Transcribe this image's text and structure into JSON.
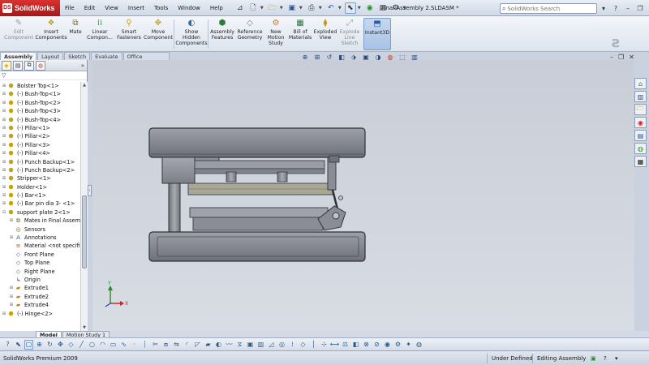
{
  "app": {
    "logo_text": "SolidWorks",
    "document_title": "Final Assembly 2.SLDASM *"
  },
  "menu": [
    "File",
    "Edit",
    "View",
    "Insert",
    "Tools",
    "Window",
    "Help"
  ],
  "search": {
    "placeholder": "SolidWorks Search"
  },
  "ribbon": {
    "buttons": [
      {
        "label": "Edit\nComponent",
        "icon": "edit-component-icon",
        "disabled": true
      },
      {
        "label": "Insert\nComponents",
        "icon": "insert-components-icon"
      },
      {
        "label": "Mate",
        "icon": "mate-icon"
      },
      {
        "label": "Linear\nCompon...",
        "icon": "linear-pattern-icon"
      },
      {
        "label": "Smart\nFasteners",
        "icon": "smart-fasteners-icon"
      },
      {
        "label": "Move\nComponent",
        "icon": "move-component-icon"
      },
      {
        "label": "Show\nHidden\nComponents",
        "icon": "show-hidden-icon"
      },
      {
        "label": "Assembly\nFeatures",
        "icon": "assembly-features-icon"
      },
      {
        "label": "Reference\nGeometry",
        "icon": "reference-geometry-icon"
      },
      {
        "label": "New\nMotion\nStudy",
        "icon": "motion-study-icon"
      },
      {
        "label": "Bill of\nMaterials",
        "icon": "bom-icon"
      },
      {
        "label": "Exploded\nView",
        "icon": "exploded-view-icon"
      },
      {
        "label": "Explode\nLine\nSketch",
        "icon": "explode-line-icon",
        "disabled": true
      },
      {
        "label": "Instant3D",
        "icon": "instant3d-icon",
        "active": true
      }
    ]
  },
  "cm_tabs": [
    "Assembly",
    "Layout",
    "Sketch",
    "Evaluate",
    "Office Products"
  ],
  "tree": [
    {
      "label": "Bolster Top<1>",
      "icon": "part",
      "expander": "+"
    },
    {
      "label": "(-) Bush-Top<1>",
      "icon": "part",
      "expander": "+"
    },
    {
      "label": "(-) Bush-Top<2>",
      "icon": "part",
      "expander": "+"
    },
    {
      "label": "(-) Bush-Top<3>",
      "icon": "part",
      "expander": "+"
    },
    {
      "label": "(-) Bush-Top<4>",
      "icon": "part",
      "expander": "+"
    },
    {
      "label": "(-) Pillar<1>",
      "icon": "part",
      "expander": "+"
    },
    {
      "label": "(-) Pillar<2>",
      "icon": "part",
      "expander": "+"
    },
    {
      "label": "(-) Pillar<3>",
      "icon": "part",
      "expander": "+"
    },
    {
      "label": "(-) Pillar<4>",
      "icon": "part",
      "expander": "+"
    },
    {
      "label": "(-) Punch Backup<1>",
      "icon": "part",
      "expander": "+"
    },
    {
      "label": "(-) Punch Backup<2>",
      "icon": "part",
      "expander": "+"
    },
    {
      "label": "Stripper<1>",
      "icon": "part",
      "expander": "+"
    },
    {
      "label": "Holder<1>",
      "icon": "part",
      "expander": "+"
    },
    {
      "label": "(-) Bar<1>",
      "icon": "part",
      "expander": "+"
    },
    {
      "label": "(-) Bar pin dia 3- <1>",
      "icon": "part",
      "expander": "+"
    },
    {
      "label": "support plate 2<1>",
      "icon": "part",
      "expander": "-"
    },
    {
      "label": "Mates in Final Assem",
      "icon": "mates",
      "expander": "+",
      "indent": 1
    },
    {
      "label": "Sensors",
      "icon": "sensor",
      "expander": "",
      "indent": 1
    },
    {
      "label": "Annotations",
      "icon": "annot",
      "expander": "+",
      "indent": 1
    },
    {
      "label": "Material <not specifi",
      "icon": "mat",
      "expander": "",
      "indent": 1
    },
    {
      "label": "Front Plane",
      "icon": "plane",
      "expander": "",
      "indent": 1
    },
    {
      "label": "Top Plane",
      "icon": "plane",
      "expander": "",
      "indent": 1
    },
    {
      "label": "Right Plane",
      "icon": "plane",
      "expander": "",
      "indent": 1
    },
    {
      "label": "Origin",
      "icon": "origin",
      "expander": "",
      "indent": 1
    },
    {
      "label": "Extrude1",
      "icon": "feat",
      "expander": "+",
      "indent": 1
    },
    {
      "label": "Extrude2",
      "icon": "feat",
      "expander": "+",
      "indent": 1
    },
    {
      "label": "Extrude4",
      "icon": "feat",
      "expander": "+",
      "indent": 1
    },
    {
      "label": "(-) Hinge<2>",
      "icon": "part",
      "expander": "+"
    }
  ],
  "bottom_tabs": [
    "Model",
    "Motion Study 1"
  ],
  "status": {
    "product": "SolidWorks Premium 2009",
    "state": "Under Defined",
    "mode": "Editing Assembly"
  },
  "axes": {
    "x": "X",
    "y": "Y"
  },
  "colors": {
    "viewport_bg": "#ccd2db",
    "part_fill": "#898b94",
    "part_dark": "#3b3d45",
    "accent": "#b8191d"
  }
}
